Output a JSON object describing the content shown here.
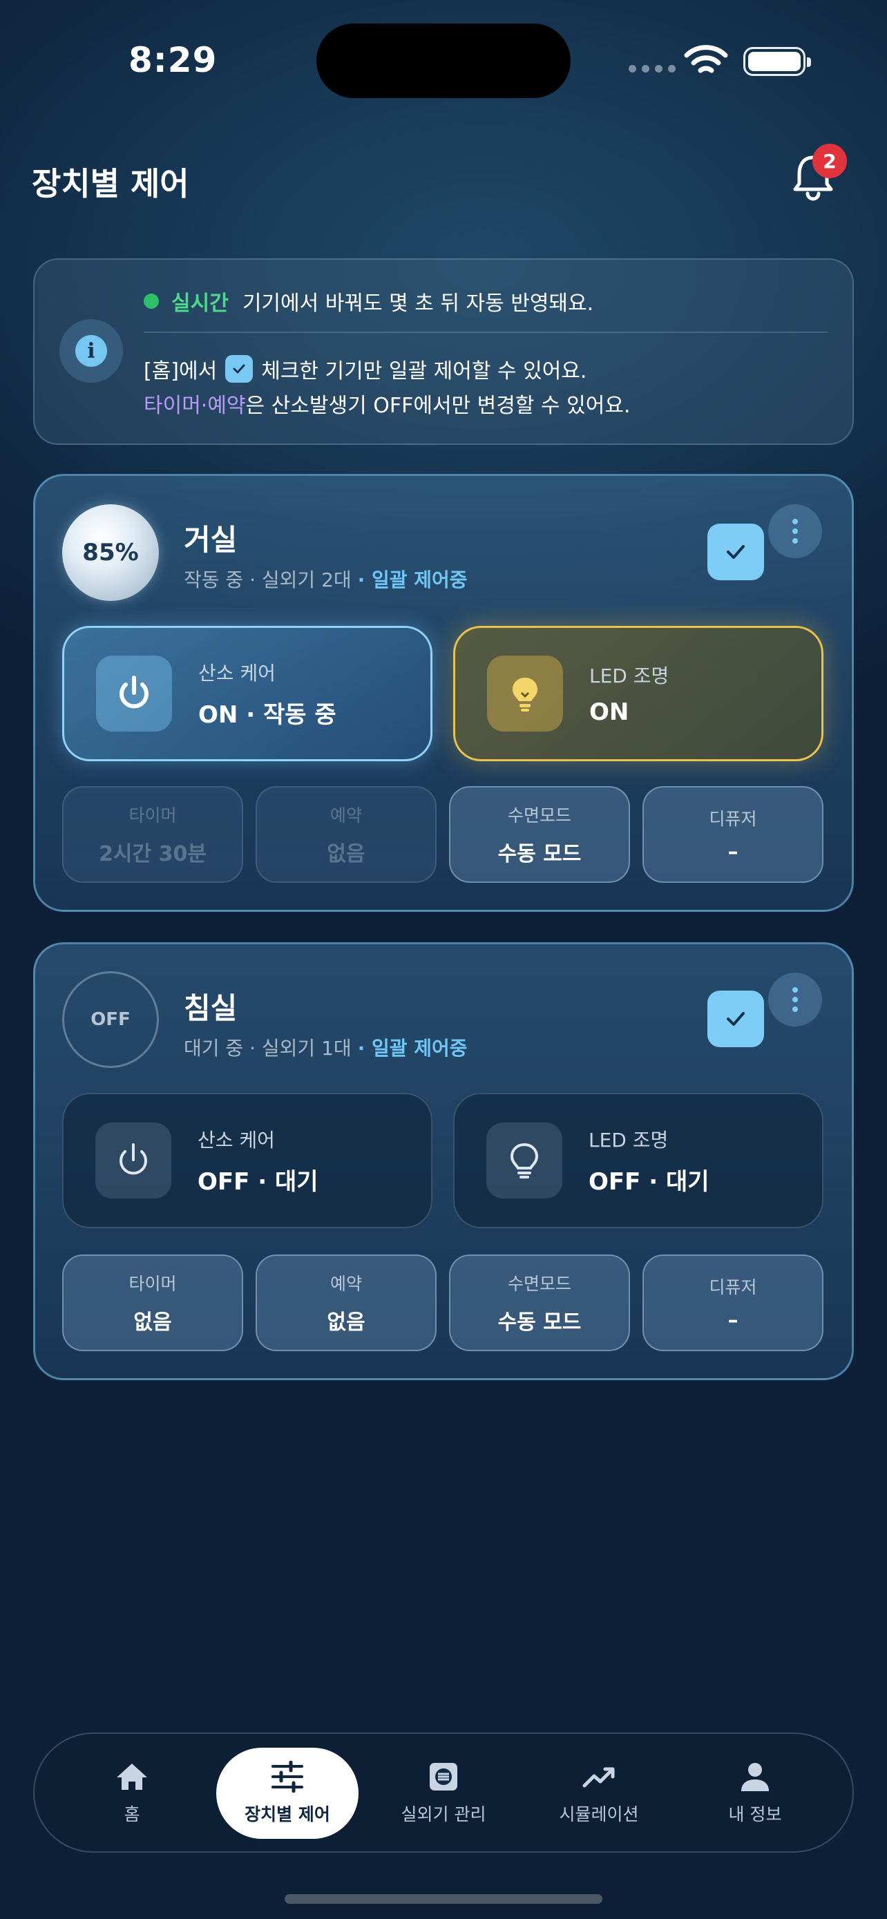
{
  "status_bar": {
    "time": "8:29"
  },
  "header": {
    "title": "장치별 제어",
    "notification_count": "2"
  },
  "info": {
    "live_label": "실시간",
    "live_text": "기기에서 바꿔도 몇 초 뒤 자동 반영돼요.",
    "line2_prefix": "[홈]에서",
    "line2_suffix": "체크한 기기만 일괄 제어할 수 있어요.",
    "line3_highlight": "타이머·예약",
    "line3_text": "은 산소발생기 OFF에서만 변경할 수 있어요."
  },
  "rooms": [
    {
      "name": "거실",
      "orb_label": "85%",
      "status": "작동 중",
      "units": "· 실외기 2대",
      "group": "· 일괄 제어중",
      "oxygen": {
        "label": "산소 케어",
        "value": "ON · 작동 중"
      },
      "led": {
        "label": "LED 조명",
        "value": "ON"
      },
      "pills": [
        {
          "label": "타이머",
          "value": "2시간 30분"
        },
        {
          "label": "예약",
          "value": "없음"
        },
        {
          "label": "수면모드",
          "value": "수동 모드"
        },
        {
          "label": "디퓨저",
          "value": "–"
        }
      ]
    },
    {
      "name": "침실",
      "orb_label": "OFF",
      "status": "대기 중",
      "units": "· 실외기 1대",
      "group": "· 일괄 제어중",
      "oxygen": {
        "label": "산소 케어",
        "value": "OFF · 대기"
      },
      "led": {
        "label": "LED 조명",
        "value": "OFF · 대기"
      },
      "pills": [
        {
          "label": "타이머",
          "value": "없음"
        },
        {
          "label": "예약",
          "value": "없음"
        },
        {
          "label": "수면모드",
          "value": "수동 모드"
        },
        {
          "label": "디퓨저",
          "value": "–"
        }
      ]
    }
  ],
  "nav": [
    {
      "label": "홈",
      "icon": "home-icon"
    },
    {
      "label": "장치별 제어",
      "icon": "sliders-icon",
      "active": true
    },
    {
      "label": "실외기 관리",
      "icon": "outdoor-unit-icon"
    },
    {
      "label": "시뮬레이션",
      "icon": "trend-icon"
    },
    {
      "label": "내 정보",
      "icon": "person-icon"
    }
  ],
  "colors": {
    "accent": "#7ecdf6",
    "live_green": "#4cd98a",
    "purple": "#b89cf5",
    "led_gold": "#e8c44e",
    "badge_red": "#e0333c"
  }
}
